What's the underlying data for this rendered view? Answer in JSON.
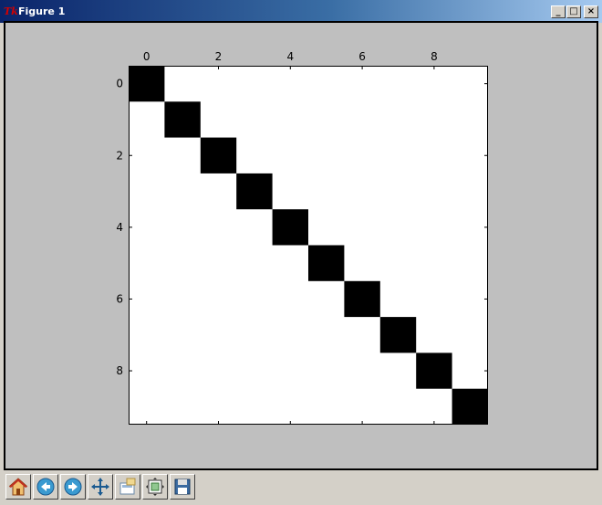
{
  "window": {
    "title": "Figure 1",
    "app_icon": "tk-feather-icon",
    "controls": {
      "minimize": "_",
      "maximize": "□",
      "close": "×"
    }
  },
  "toolbar": {
    "tools": [
      {
        "name": "home",
        "icon": "home-icon"
      },
      {
        "name": "back",
        "icon": "back-arrow-icon"
      },
      {
        "name": "forward",
        "icon": "forward-arrow-icon"
      },
      {
        "name": "pan",
        "icon": "pan-move-icon"
      },
      {
        "name": "zoom",
        "icon": "zoom-rect-icon"
      },
      {
        "name": "subplots",
        "icon": "subplots-config-icon"
      },
      {
        "name": "save",
        "icon": "save-disk-icon"
      }
    ]
  },
  "colors": {
    "figure_bg": "#bfbfbf",
    "cell_on": "#000000",
    "cell_off": "#ffffff"
  },
  "chart_data": {
    "type": "heatmap",
    "title": "",
    "xlabel": "",
    "ylabel": "",
    "x_ticks_position": "top",
    "x_tick_labels": [
      "0",
      "2",
      "4",
      "6",
      "8"
    ],
    "y_tick_labels": [
      "0",
      "2",
      "4",
      "6",
      "8"
    ],
    "xlim": [
      -0.5,
      9.5
    ],
    "ylim": [
      9.5,
      -0.5
    ],
    "grid": false,
    "colormap": "binary",
    "matrix": [
      [
        1,
        0,
        0,
        0,
        0,
        0,
        0,
        0,
        0,
        0
      ],
      [
        0,
        1,
        0,
        0,
        0,
        0,
        0,
        0,
        0,
        0
      ],
      [
        0,
        0,
        1,
        0,
        0,
        0,
        0,
        0,
        0,
        0
      ],
      [
        0,
        0,
        0,
        1,
        0,
        0,
        0,
        0,
        0,
        0
      ],
      [
        0,
        0,
        0,
        0,
        1,
        0,
        0,
        0,
        0,
        0
      ],
      [
        0,
        0,
        0,
        0,
        0,
        1,
        0,
        0,
        0,
        0
      ],
      [
        0,
        0,
        0,
        0,
        0,
        0,
        1,
        0,
        0,
        0
      ],
      [
        0,
        0,
        0,
        0,
        0,
        0,
        0,
        1,
        0,
        0
      ],
      [
        0,
        0,
        0,
        0,
        0,
        0,
        0,
        0,
        1,
        0
      ],
      [
        0,
        0,
        0,
        0,
        0,
        0,
        0,
        0,
        0,
        1
      ]
    ]
  }
}
